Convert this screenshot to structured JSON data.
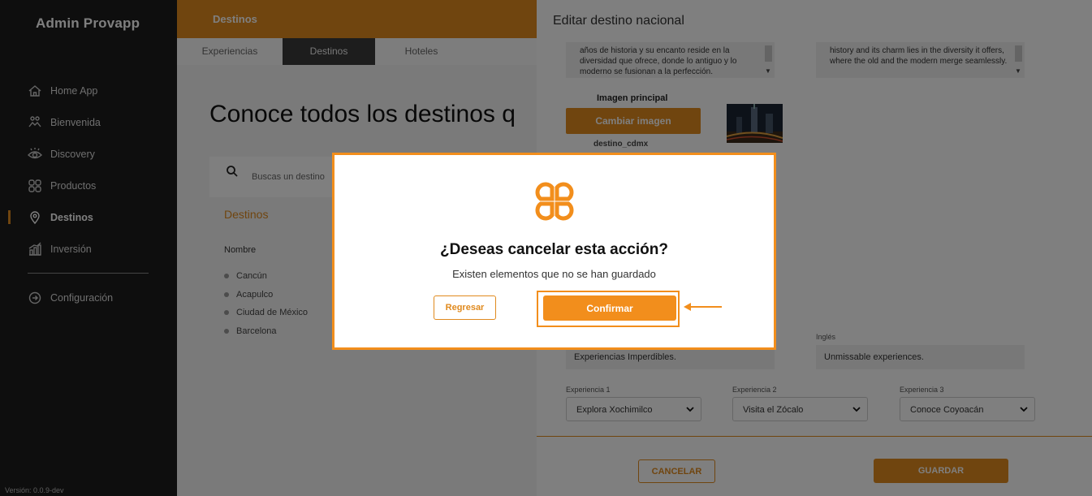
{
  "sidebar": {
    "brand": "Admin Provapp",
    "items": [
      {
        "label": "Home App",
        "icon": "home-icon"
      },
      {
        "label": "Bienvenida",
        "icon": "handshake-icon"
      },
      {
        "label": "Discovery",
        "icon": "eye-icon"
      },
      {
        "label": "Productos",
        "icon": "grid-icon"
      },
      {
        "label": "Destinos",
        "icon": "location-pin-icon",
        "active": true
      },
      {
        "label": "Inversión",
        "icon": "chart-icon"
      }
    ],
    "config_label": "Configuración",
    "version": "Versión: 0.0.9-dev"
  },
  "header": {
    "title": "Destinos",
    "tabs": [
      {
        "label": "Experiencias"
      },
      {
        "label": "Destinos",
        "active": true
      },
      {
        "label": "Hoteles"
      }
    ]
  },
  "main": {
    "heading": "Conoce todos los destinos q",
    "search_placeholder": "Buscas un destino",
    "section_title": "Destinos",
    "column_header": "Nombre",
    "destinations": [
      "Cancún",
      "Acapulco",
      "Ciudad de México",
      "Barcelona"
    ]
  },
  "panel": {
    "title": "Editar destino nacional",
    "description_es": "años de historia y su encanto reside en la diversidad que ofrece, donde lo antiguo y lo moderno se fusionan a la perfección.",
    "description_en": "history and its charm lies in the diversity it offers, where the old and the modern merge seamlessly.",
    "image_label": "Imagen principal",
    "change_image_label": "Cambiar imagen",
    "image_filename": "destino_cdmx",
    "english_label": "Inglés",
    "slogan_es": "Experiencias Imperdibles.",
    "slogan_en": "Unmissable experiences.",
    "experiences": [
      {
        "label": "Experiencia 1",
        "value": "Explora Xochimilco"
      },
      {
        "label": "Experiencia 2",
        "value": "Visita el Zócalo"
      },
      {
        "label": "Experiencia 3",
        "value": "Conoce Coyoacán"
      }
    ],
    "cancel_label": "CANCELAR",
    "save_label": "GUARDAR"
  },
  "modal": {
    "title": "¿Deseas cancelar esta acción?",
    "subtitle": "Existen elementos que no se han guardado",
    "back_label": "Regresar",
    "confirm_label": "Confirmar"
  },
  "colors": {
    "accent": "#e08a1e",
    "highlight": "#f28e1c",
    "sidebar_bg": "#1c1c1c"
  }
}
